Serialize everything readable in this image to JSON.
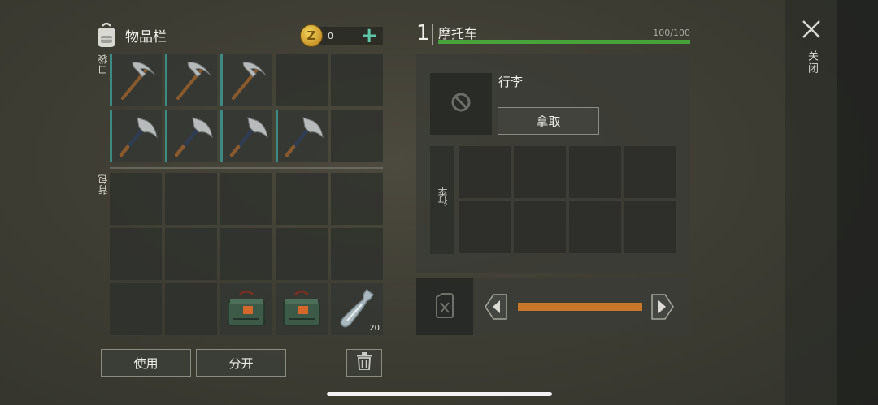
{
  "inventory": {
    "title": "物品栏",
    "coins": "0",
    "coin_symbol": "Z",
    "plus": "+",
    "pockets_label": "口袋",
    "backpack_label": "背包",
    "pockets": [
      {
        "item": "pickaxe-icon",
        "border": true
      },
      {
        "item": "pickaxe-icon",
        "border": true
      },
      {
        "item": "pickaxe-icon",
        "border": true
      },
      {
        "item": "",
        "border": false
      },
      {
        "item": "",
        "border": false
      },
      {
        "item": "hatchet-icon",
        "border": true
      },
      {
        "item": "hatchet-icon",
        "border": true
      },
      {
        "item": "hatchet-icon",
        "border": true
      },
      {
        "item": "hatchet-icon",
        "border": true
      },
      {
        "item": "",
        "border": false
      }
    ],
    "backpack": [
      {
        "item": ""
      },
      {
        "item": ""
      },
      {
        "item": ""
      },
      {
        "item": ""
      },
      {
        "item": ""
      },
      {
        "item": ""
      },
      {
        "item": ""
      },
      {
        "item": ""
      },
      {
        "item": ""
      },
      {
        "item": ""
      },
      {
        "item": ""
      },
      {
        "item": ""
      },
      {
        "item": "explosive-box-icon"
      },
      {
        "item": "explosive-box-icon"
      },
      {
        "item": "plastic-bottle-icon",
        "qty": "20"
      }
    ],
    "use_label": "使用",
    "split_label": "分开"
  },
  "vehicle": {
    "number": "1",
    "name": "摩托车",
    "durability_text": "100/100",
    "durability": 1.0,
    "trunk_title": "行李",
    "take_label": "拿取",
    "trunk_side_label": "行李",
    "fuel_level": 1.0
  },
  "close_label": "关闭",
  "colors": {
    "accent_teal": "#3d8a83",
    "durability_green": "#47a23a",
    "fuel_orange": "#c7762a",
    "plus_green": "#5fc6a6"
  }
}
